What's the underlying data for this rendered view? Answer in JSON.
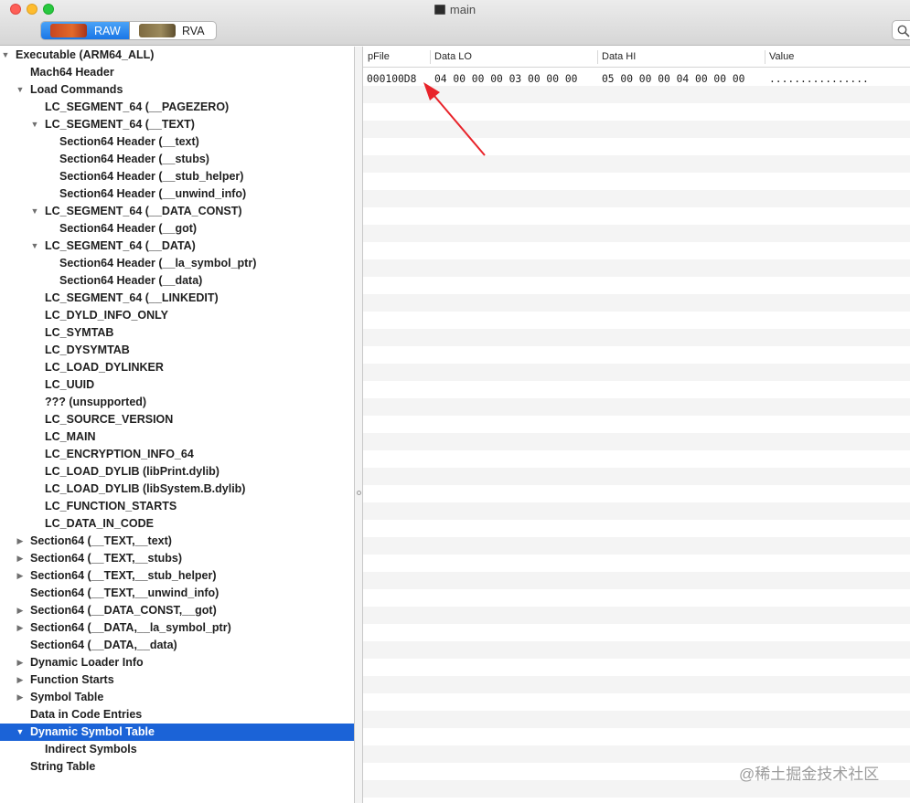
{
  "window": {
    "title": "main",
    "buttons": {
      "close": "close",
      "minimize": "minimize",
      "zoom": "zoom"
    }
  },
  "toolbar": {
    "segments": [
      {
        "label": "RAW",
        "selected": true
      },
      {
        "label": "RVA",
        "selected": false
      }
    ],
    "search_icon": "search-icon"
  },
  "sidebar": {
    "items": [
      {
        "label": "Executable  (ARM64_ALL)",
        "level": 0,
        "disclosure": "expanded"
      },
      {
        "label": "Mach64 Header",
        "level": 1,
        "disclosure": "none"
      },
      {
        "label": "Load Commands",
        "level": 1,
        "disclosure": "expanded"
      },
      {
        "label": "LC_SEGMENT_64 (__PAGEZERO)",
        "level": 2,
        "disclosure": "none"
      },
      {
        "label": "LC_SEGMENT_64 (__TEXT)",
        "level": 2,
        "disclosure": "expanded"
      },
      {
        "label": "Section64 Header (__text)",
        "level": 3,
        "disclosure": "none"
      },
      {
        "label": "Section64 Header (__stubs)",
        "level": 3,
        "disclosure": "none"
      },
      {
        "label": "Section64 Header (__stub_helper)",
        "level": 3,
        "disclosure": "none"
      },
      {
        "label": "Section64 Header (__unwind_info)",
        "level": 3,
        "disclosure": "none"
      },
      {
        "label": "LC_SEGMENT_64 (__DATA_CONST)",
        "level": 2,
        "disclosure": "expanded"
      },
      {
        "label": "Section64 Header (__got)",
        "level": 3,
        "disclosure": "none"
      },
      {
        "label": "LC_SEGMENT_64 (__DATA)",
        "level": 2,
        "disclosure": "expanded"
      },
      {
        "label": "Section64 Header (__la_symbol_ptr)",
        "level": 3,
        "disclosure": "none"
      },
      {
        "label": "Section64 Header (__data)",
        "level": 3,
        "disclosure": "none"
      },
      {
        "label": "LC_SEGMENT_64 (__LINKEDIT)",
        "level": 2,
        "disclosure": "none"
      },
      {
        "label": "LC_DYLD_INFO_ONLY",
        "level": 2,
        "disclosure": "none"
      },
      {
        "label": "LC_SYMTAB",
        "level": 2,
        "disclosure": "none"
      },
      {
        "label": "LC_DYSYMTAB",
        "level": 2,
        "disclosure": "none"
      },
      {
        "label": "LC_LOAD_DYLINKER",
        "level": 2,
        "disclosure": "none"
      },
      {
        "label": "LC_UUID",
        "level": 2,
        "disclosure": "none"
      },
      {
        "label": "??? (unsupported)",
        "level": 2,
        "disclosure": "none"
      },
      {
        "label": "LC_SOURCE_VERSION",
        "level": 2,
        "disclosure": "none"
      },
      {
        "label": "LC_MAIN",
        "level": 2,
        "disclosure": "none"
      },
      {
        "label": "LC_ENCRYPTION_INFO_64",
        "level": 2,
        "disclosure": "none"
      },
      {
        "label": "LC_LOAD_DYLIB (libPrint.dylib)",
        "level": 2,
        "disclosure": "none"
      },
      {
        "label": "LC_LOAD_DYLIB (libSystem.B.dylib)",
        "level": 2,
        "disclosure": "none"
      },
      {
        "label": "LC_FUNCTION_STARTS",
        "level": 2,
        "disclosure": "none"
      },
      {
        "label": "LC_DATA_IN_CODE",
        "level": 2,
        "disclosure": "none"
      },
      {
        "label": "Section64 (__TEXT,__text)",
        "level": 1,
        "disclosure": "collapsed"
      },
      {
        "label": "Section64 (__TEXT,__stubs)",
        "level": 1,
        "disclosure": "collapsed"
      },
      {
        "label": "Section64 (__TEXT,__stub_helper)",
        "level": 1,
        "disclosure": "collapsed"
      },
      {
        "label": "Section64 (__TEXT,__unwind_info)",
        "level": 1,
        "disclosure": "none"
      },
      {
        "label": "Section64 (__DATA_CONST,__got)",
        "level": 1,
        "disclosure": "collapsed"
      },
      {
        "label": "Section64 (__DATA,__la_symbol_ptr)",
        "level": 1,
        "disclosure": "collapsed"
      },
      {
        "label": "Section64 (__DATA,__data)",
        "level": 1,
        "disclosure": "none"
      },
      {
        "label": "Dynamic Loader Info",
        "level": 1,
        "disclosure": "collapsed"
      },
      {
        "label": "Function Starts",
        "level": 1,
        "disclosure": "collapsed"
      },
      {
        "label": "Symbol Table",
        "level": 1,
        "disclosure": "collapsed"
      },
      {
        "label": "Data in Code Entries",
        "level": 1,
        "disclosure": "none"
      },
      {
        "label": "Dynamic Symbol Table",
        "level": 1,
        "disclosure": "expanded",
        "selected": true
      },
      {
        "label": "Indirect Symbols",
        "level": 2,
        "disclosure": "none"
      },
      {
        "label": "String Table",
        "level": 1,
        "disclosure": "none"
      }
    ]
  },
  "table": {
    "columns": [
      "pFile",
      "Data LO",
      "Data HI",
      "Value"
    ],
    "rows": [
      {
        "pfile": "000100D8",
        "data_lo": "04 00 00 00 03 00 00 00",
        "data_hi": "05 00 00 00 04 00 00 00",
        "value": "................"
      }
    ]
  },
  "colors": {
    "selection": "#1b63d7",
    "annotation_arrow": "#e8232a",
    "segment_selected": "#1a76e6"
  },
  "watermark": "@稀土掘金技术社区"
}
